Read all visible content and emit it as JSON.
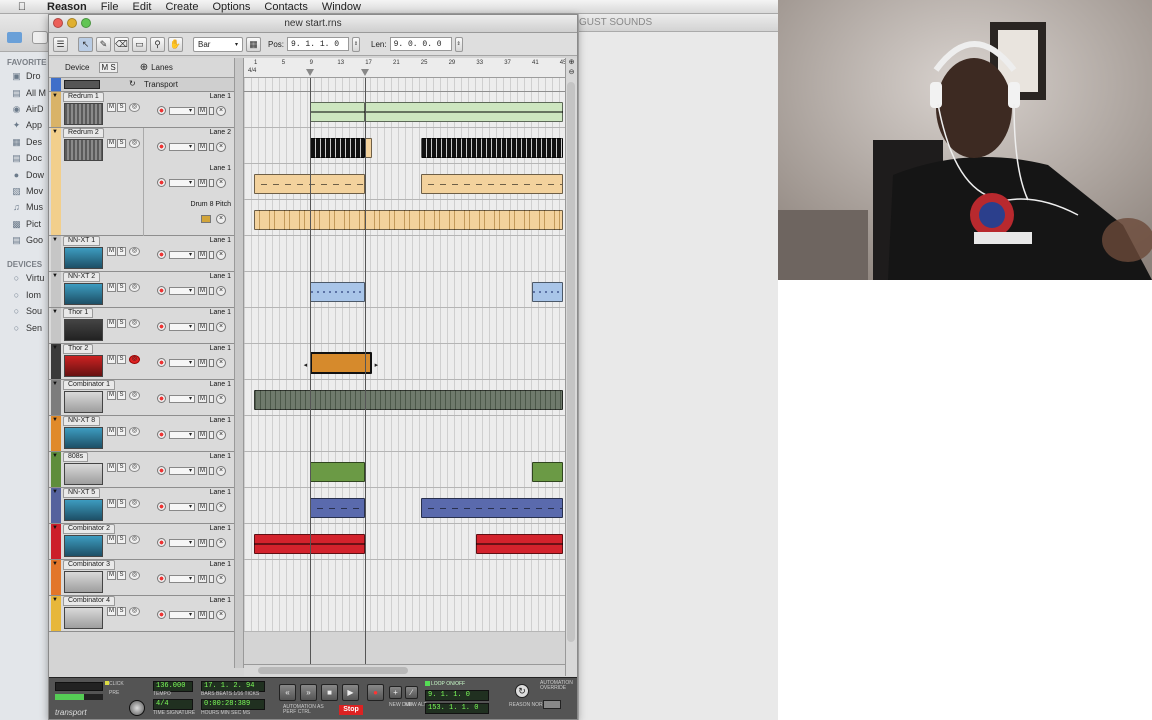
{
  "menubar": {
    "app": "Reason",
    "items": [
      "File",
      "Edit",
      "Create",
      "Options",
      "Contacts",
      "Window"
    ]
  },
  "window": {
    "title": "new start.rns"
  },
  "background_window": {
    "title": "GUST SOUNDS"
  },
  "finder": {
    "favorites_header": "FAVORITE",
    "favorites": [
      {
        "icon": "monitor-icon",
        "label": "Dro"
      },
      {
        "icon": "folder-icon",
        "label": "All M"
      },
      {
        "icon": "airdrop-icon",
        "label": "AirD"
      },
      {
        "icon": "app-icon",
        "label": "App"
      },
      {
        "icon": "desktop-icon",
        "label": "Des"
      },
      {
        "icon": "document-icon",
        "label": "Doc"
      },
      {
        "icon": "download-icon",
        "label": "Dow"
      },
      {
        "icon": "movie-icon",
        "label": "Mov"
      },
      {
        "icon": "music-icon",
        "label": "Mus"
      },
      {
        "icon": "picture-icon",
        "label": "Pict"
      },
      {
        "icon": "folder-icon",
        "label": "Goo"
      }
    ],
    "devices_header": "DEVICES",
    "devices": [
      {
        "icon": "disk-icon",
        "label": "Virtu"
      },
      {
        "icon": "disk-icon",
        "label": "Iom"
      },
      {
        "icon": "disk-icon",
        "label": "Sou"
      },
      {
        "icon": "disk-icon",
        "label": "Sen"
      }
    ]
  },
  "toolbar": {
    "snap_value": "Bar",
    "pos_label": "Pos:",
    "pos_value": "9. 1. 1.  0",
    "len_label": "Len:",
    "len_value": "9. 0. 0.  0"
  },
  "header": {
    "device_label": "Device",
    "ms": "M S",
    "lanes_label": "Lanes"
  },
  "ruler": {
    "time_sig": "4/4",
    "ticks": [
      "1",
      "5",
      "9",
      "13",
      "17",
      "21",
      "25",
      "29",
      "33",
      "37",
      "41",
      "45"
    ]
  },
  "transport_track": {
    "label": "Transport"
  },
  "tracks": [
    {
      "name": "Redrum 1",
      "color": "#d9b368",
      "thumb": "redrum",
      "lanes": [
        "Lane 1"
      ]
    },
    {
      "name": "Redrum 2",
      "color": "#f2cf8c",
      "thumb": "redrum",
      "lanes": [
        "Lane 2",
        "Lane 1",
        "Drum 8 Pitch"
      ]
    },
    {
      "name": "NN-XT 1",
      "color": "#c6c6c6",
      "thumb": "nnxt",
      "lanes": [
        "Lane 1"
      ]
    },
    {
      "name": "NN-XT 2",
      "color": "#c6c6c6",
      "thumb": "nnxt",
      "lanes": [
        "Lane 1"
      ]
    },
    {
      "name": "Thor 1",
      "color": "#c6c6c6",
      "thumb": "thor",
      "lanes": [
        "Lane 1"
      ]
    },
    {
      "name": "Thor 2",
      "color": "#3a3a3a",
      "thumb": "thor-red",
      "lanes": [
        "Lane 1"
      ]
    },
    {
      "name": "Combinator 1",
      "color": "#7d7d7d",
      "thumb": "combi",
      "lanes": [
        "Lane 1"
      ]
    },
    {
      "name": "NN-XT 8",
      "color": "#e08a2a",
      "thumb": "nnxt",
      "lanes": [
        "Lane 1"
      ]
    },
    {
      "name": "808s",
      "color": "#5f8d3c",
      "thumb": "combi",
      "lanes": [
        "Lane 1"
      ]
    },
    {
      "name": "NN-XT 5",
      "color": "#55629d",
      "thumb": "nnxt",
      "lanes": [
        "Lane 1"
      ]
    },
    {
      "name": "Combinator 2",
      "color": "#cc1f2a",
      "thumb": "nnxt",
      "lanes": [
        "Lane 1"
      ]
    },
    {
      "name": "Combinator 3",
      "color": "#e2762a",
      "thumb": "combi",
      "lanes": [
        "Lane 1"
      ]
    },
    {
      "name": "Combinator 4",
      "color": "#e7b73a",
      "thumb": "combi",
      "lanes": [
        "Lane 1"
      ]
    }
  ],
  "transport": {
    "click": "CLICK",
    "pre": "PRE",
    "tempo": "136.000",
    "tempo_label": "TEMPO",
    "signature": "4/4",
    "signature_label": "TIME SIGNATURE",
    "position": "17. 1. 2. 94",
    "position_label": "BARS BEATS 1/16 TICKS",
    "time": "0:00:28:389",
    "time_label": "HOURS MIN SEC MS",
    "stop_label": "Stop",
    "automation_label": "AUTOMATION AS PERF CTRL",
    "new_dub": "NEW DUB",
    "new_alt": "NEW ALT",
    "loop_label": "LOOP ON/OFF",
    "loop_left": "9. 1. 1.  0",
    "loop_right": "153. 1. 1.  0",
    "reason_label": "REASON NORM",
    "override_label": "AUTOMATION OVERRIDE",
    "footer": "transport"
  }
}
